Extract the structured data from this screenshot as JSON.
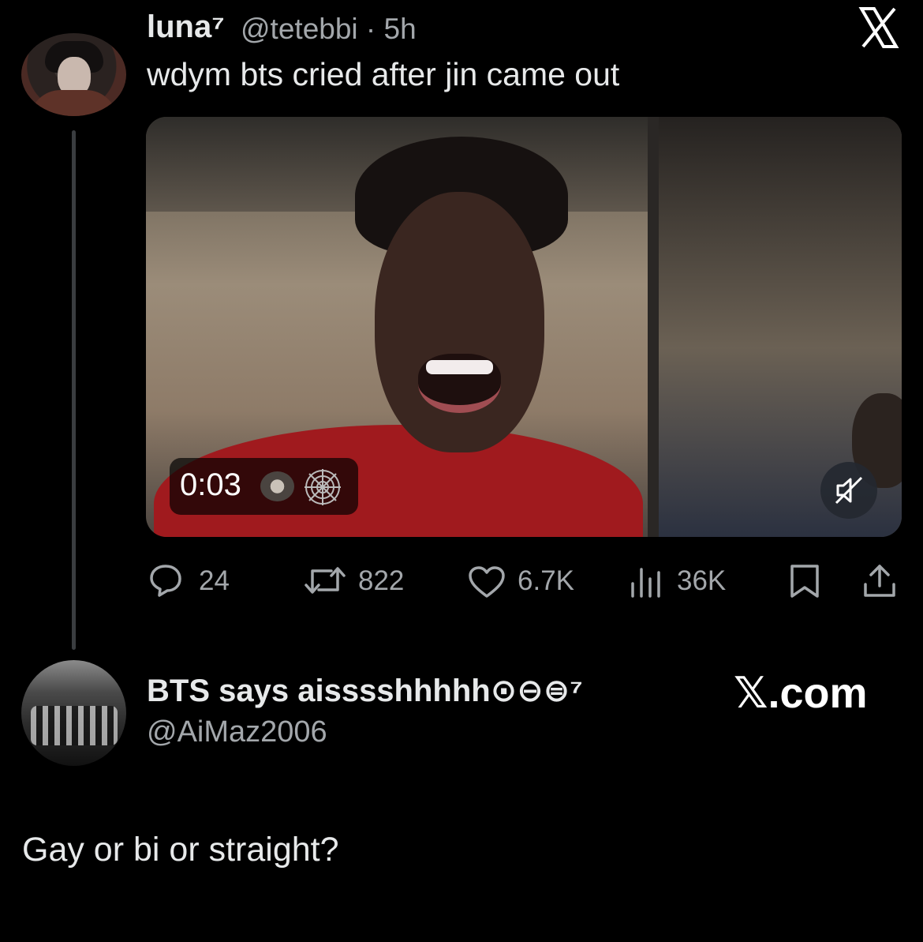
{
  "tweet": {
    "display_name": "luna⁷",
    "handle": "@tetebbi",
    "separator": "·",
    "time": "5h",
    "meta": "@tetebbi · 5h",
    "text": "wdym bts cried after jin came out",
    "video": {
      "duration": "0:03",
      "muted": true
    },
    "actions": {
      "replies": "24",
      "reposts": "822",
      "likes": "6.7K",
      "views": "36K"
    }
  },
  "reply": {
    "display_name": "BTS says aisssshhhhh⊙⊖⊜⁷",
    "handle": "@AiMaz2006",
    "text": "Gay or bi or straight?"
  },
  "watermark": "𝕏.com",
  "icons": [
    "x-logo-icon",
    "web-icon",
    "mute-icon",
    "reply-icon",
    "repost-icon",
    "like-icon",
    "views-icon",
    "bookmark-icon",
    "share-icon"
  ],
  "colors": {
    "background": "#000000",
    "primary_text": "#e7e9ea",
    "secondary_text": "#a3a7ab",
    "thread_line": "#3a3d40"
  }
}
